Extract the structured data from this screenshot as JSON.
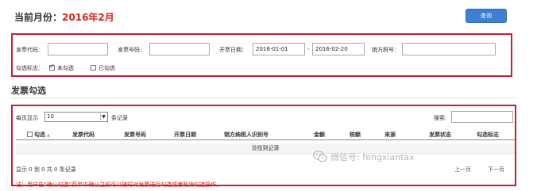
{
  "header": {
    "month_label": "当前月份：",
    "month_value": "2016年2月",
    "query_label": "查询"
  },
  "filters": {
    "invoice_code_label": "发票代码：",
    "invoice_code_value": "",
    "invoice_number_label": "发票号码：",
    "invoice_number_value": "",
    "issue_date_label": "开票日期：",
    "date_from": "2016-01-01",
    "date_separator": "-",
    "date_to": "2016-02-20",
    "seller_tax_label": "销方税号：",
    "seller_tax_value": "",
    "check_flag_label": "勾选标志：",
    "unchecked_option": "未勾选",
    "checked_option": "已勾选",
    "unchecked_option_selected": true,
    "checked_option_selected": false
  },
  "section": {
    "title": "发票勾选"
  },
  "table": {
    "page_size_prefix": "每页显示",
    "page_size_value": "10",
    "page_size_suffix": "条记录",
    "search_label": "搜索:",
    "search_value": "",
    "columns": [
      "勾选",
      "发票代码",
      "发票号码",
      "开票日期",
      "销方纳税人识别号",
      "金额",
      "税额",
      "来源",
      "发票状态",
      "勾选标志"
    ],
    "empty_message": "没找到记录",
    "info": "显示 0 到 0 共 0 条记录",
    "prev_label": "上一页",
    "next_label": "下一页",
    "note": "注：用户在“确认勾选”菜单中确认之前可以随时对发票进行勾选或者取消勾选操作。"
  },
  "watermark": {
    "text": "微信号: fengxiantax"
  },
  "colors": {
    "accent_red": "#d9231c",
    "panel_border": "#cc1f2d",
    "button_blue": "#3d7fd0"
  }
}
